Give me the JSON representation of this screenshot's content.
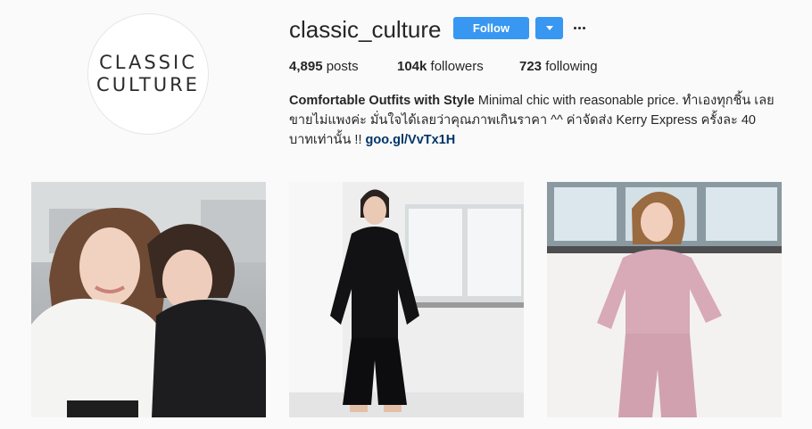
{
  "profile": {
    "avatar_line1": "CLASSIC",
    "avatar_line2": "CULTURE",
    "username": "classic_culture",
    "follow_label": "Follow",
    "posts_count": "4,895",
    "posts_label": "posts",
    "followers_count": "104k",
    "followers_label": "followers",
    "following_count": "723",
    "following_label": "following",
    "bio_title": "Comfortable Outfits with Style",
    "bio_text": "Minimal chic with reasonable price. ทำเองทุกชิ้น เลยขายไม่แพงค่ะ มั่นใจได้เลยว่าคุณภาพเกินราคา ^^ ค่าจัดส่ง Kerry Express ครั้งละ 40 บาทเท่านั้น !!",
    "bio_link": "goo.gl/VvTx1H"
  },
  "colors": {
    "background": "#fafafa",
    "button_blue": "#3897f0",
    "link": "#003569"
  },
  "icons": {
    "dropdown": "chevron-down-icon",
    "more": "more-options-icon"
  },
  "posts": [
    {
      "subject": "two women, white and black tops"
    },
    {
      "subject": "woman in black knit set"
    },
    {
      "subject": "woman in pink knit set"
    }
  ]
}
